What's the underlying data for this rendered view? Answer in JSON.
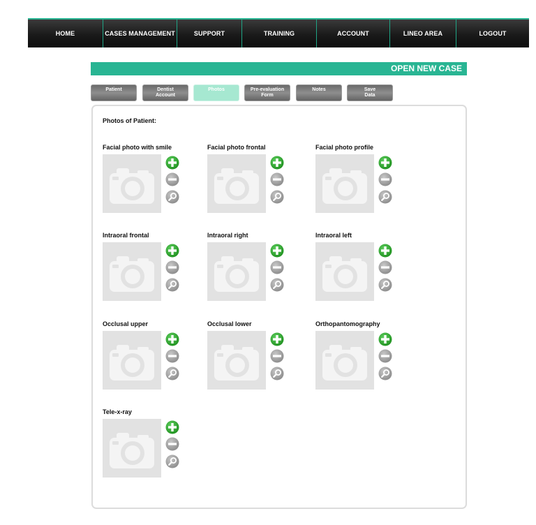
{
  "nav": {
    "items": [
      {
        "label": "HOME"
      },
      {
        "label": "CASES MANAGEMENT"
      },
      {
        "label": "SUPPORT"
      },
      {
        "label": "TRAINING"
      },
      {
        "label": "ACCOUNT"
      },
      {
        "label": "LINEO AREA"
      },
      {
        "label": "LOGOUT"
      }
    ]
  },
  "header": {
    "title": "OPEN NEW CASE"
  },
  "tabs": [
    {
      "line1": "Patient",
      "line2": "",
      "active": false
    },
    {
      "line1": "Dentist",
      "line2": "Account",
      "active": false
    },
    {
      "line1": "Photos",
      "line2": "",
      "active": true
    },
    {
      "line1": "Pre-evaluation",
      "line2": "Form",
      "active": false
    },
    {
      "line1": "Notes",
      "line2": "",
      "active": false
    },
    {
      "line1": "Save",
      "line2": "Data",
      "active": false
    }
  ],
  "photos": {
    "title": "Photos of Patient:",
    "slots": [
      {
        "label": "Facial photo with smile"
      },
      {
        "label": "Facial photo frontal"
      },
      {
        "label": "Facial photo profile"
      },
      {
        "label": "Intraoral frontal"
      },
      {
        "label": "Intraoral right"
      },
      {
        "label": "Intraoral left"
      },
      {
        "label": "Occlusal upper"
      },
      {
        "label": "Occlusal lower"
      },
      {
        "label": "Orthopantomography"
      },
      {
        "label": "Tele-x-ray"
      }
    ]
  },
  "icons": {
    "add": "plus-circle-icon",
    "remove": "minus-circle-icon",
    "zoom": "magnifier-icon",
    "placeholder": "camera-icon"
  },
  "colors": {
    "accent": "#29b593",
    "nav_bg": "#1a1a1a",
    "tab_active": "#a6e8d1",
    "tab_inactive": "#7a7a7a",
    "add_green": "#2aa52a",
    "button_gray": "#9a9a9a"
  }
}
